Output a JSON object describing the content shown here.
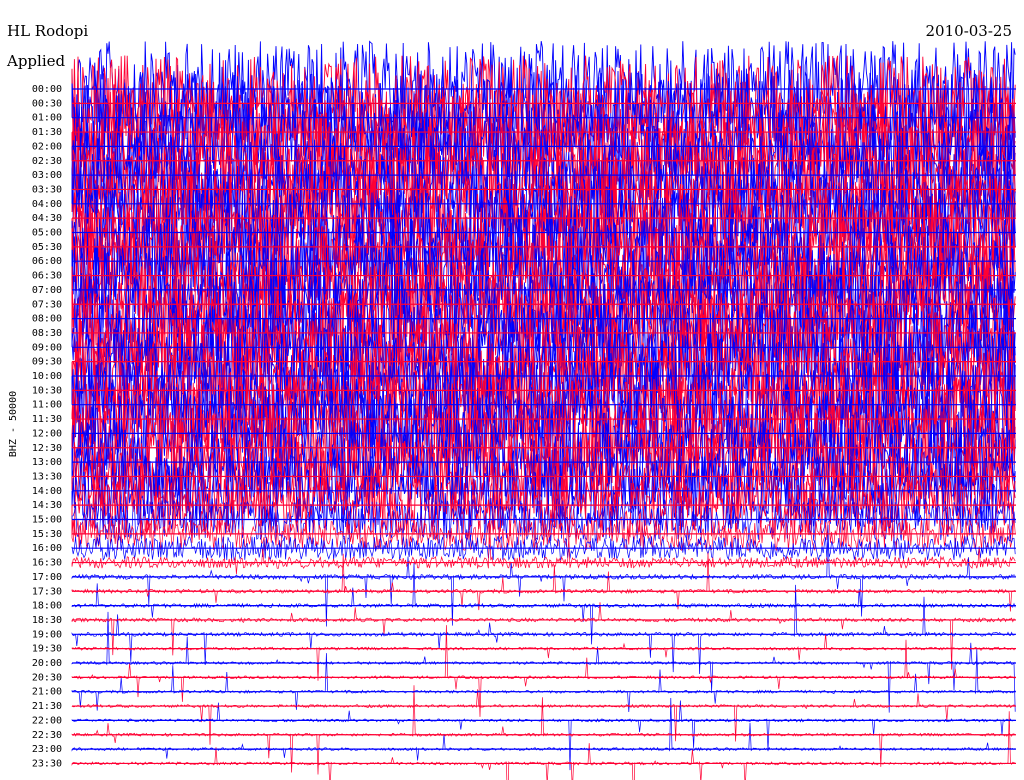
{
  "header": {
    "station": "HL Rodopi",
    "date": "2010-03-25",
    "filter": "Applied"
  },
  "chart_data": {
    "type": "line",
    "title": "HL Rodopi",
    "ylabel": "BHZ - 50000",
    "row_labels": [
      "00:00",
      "00:30",
      "01:00",
      "01:30",
      "02:00",
      "02:30",
      "03:00",
      "03:30",
      "04:00",
      "04:30",
      "05:00",
      "05:30",
      "06:00",
      "06:30",
      "07:00",
      "07:30",
      "08:00",
      "08:30",
      "09:00",
      "09:30",
      "10:00",
      "10:30",
      "11:00",
      "11:30",
      "12:00",
      "12:30",
      "13:00",
      "13:30",
      "14:00",
      "14:30",
      "15:00",
      "15:30",
      "16:00",
      "16:30",
      "17:00",
      "17:30",
      "18:00",
      "18:30",
      "19:00",
      "19:30",
      "20:00",
      "20:30",
      "21:00",
      "21:30",
      "22:00",
      "22:30",
      "23:00",
      "23:30"
    ],
    "colors": [
      "#0000ff",
      "#ff0033"
    ],
    "noise_level_by_row": [
      1.0,
      1.0,
      1.0,
      1.0,
      1.0,
      1.0,
      1.0,
      1.0,
      1.0,
      1.0,
      1.0,
      1.0,
      1.0,
      1.0,
      1.0,
      1.0,
      1.0,
      1.0,
      1.0,
      1.0,
      1.0,
      1.0,
      1.0,
      1.0,
      1.0,
      0.95,
      0.85,
      0.8,
      0.75,
      0.65,
      0.45,
      0.35,
      0.25,
      0.12,
      0.05,
      0.04,
      0.04,
      0.04,
      0.04,
      0.03,
      0.03,
      0.03,
      0.03,
      0.03,
      0.03,
      0.03,
      0.03,
      0.03
    ]
  }
}
